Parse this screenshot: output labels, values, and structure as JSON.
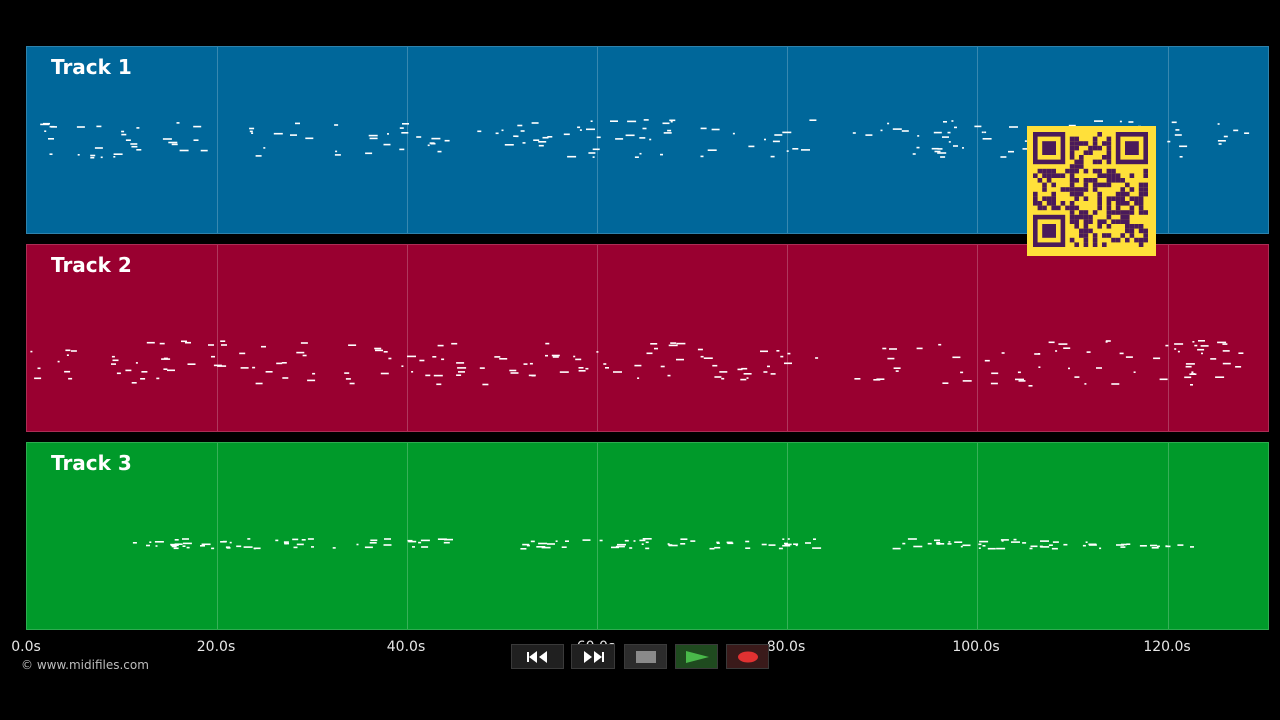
{
  "tracks": [
    {
      "label": "Track 1",
      "color": "#00679A"
    },
    {
      "label": "Track 2",
      "color": "#990030"
    },
    {
      "label": "Track 3",
      "color": "#009A2A"
    }
  ],
  "timeline": {
    "ticks": [
      "0.0s",
      "20.0s",
      "40.0s",
      "60.0s",
      "80.0s",
      "100.0s",
      "120.0s"
    ],
    "unit": "s"
  },
  "footer": {
    "copyright": "© www.midifiles.com"
  },
  "qr_code": {
    "colors": {
      "background": "#FFE03A",
      "modules": "#4A1A5A"
    }
  },
  "transport": {
    "buttons": [
      {
        "name": "rewind-button",
        "icon": "rewind-icon"
      },
      {
        "name": "fast-forward-button",
        "icon": "fast-forward-icon"
      },
      {
        "name": "stop-button",
        "icon": "stop-icon"
      },
      {
        "name": "play-button",
        "icon": "play-icon",
        "active": true
      },
      {
        "name": "record-button",
        "icon": "record-icon"
      }
    ]
  }
}
